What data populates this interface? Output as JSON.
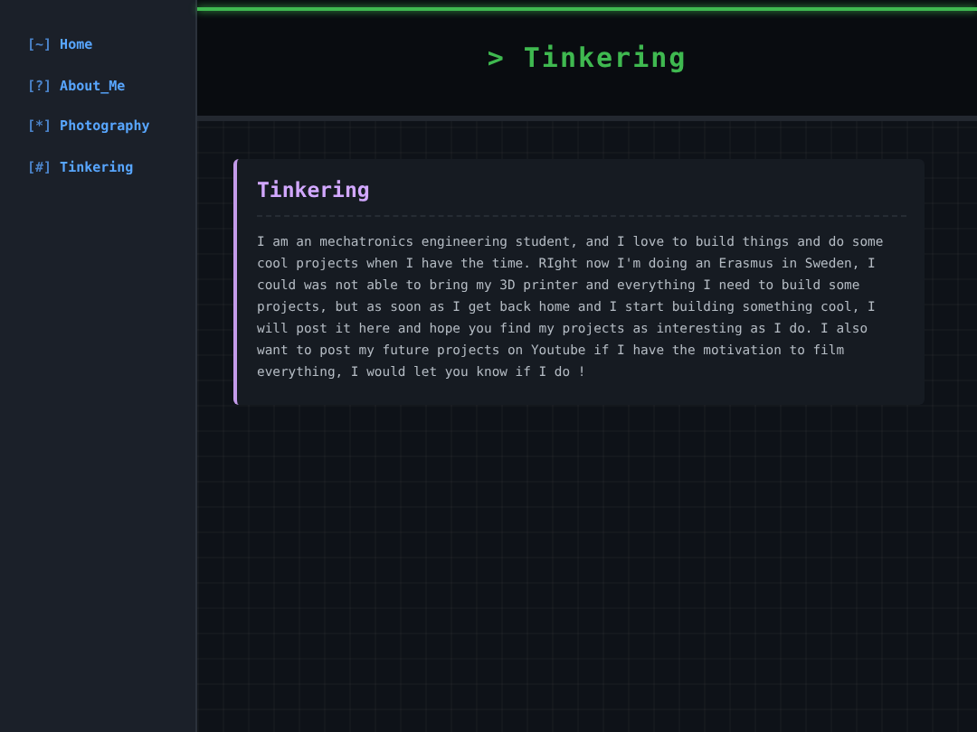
{
  "sidebar": {
    "items": [
      {
        "icon": "[~]",
        "label": "Home"
      },
      {
        "icon": "[?]",
        "label": "About_Me"
      },
      {
        "icon": "[*]",
        "label": "Photography"
      },
      {
        "icon": "[#]",
        "label": "Tinkering"
      }
    ]
  },
  "header": {
    "title": "> Tinkering"
  },
  "card": {
    "title": "Tinkering",
    "text": "I am an mechatronics engineering student, and I love to build things and do some cool projects when I have the time. RIght now I'm doing an Erasmus in Sweden, I could was not able to bring my 3D printer and everything I need to build some projects, but as soon as I get back home and I start building something cool, I will post it here and hope you find my projects as interesting as I do. I also want to post my future projects on Youtube if I have the motivation to film everything, I would let you know if I do !"
  }
}
